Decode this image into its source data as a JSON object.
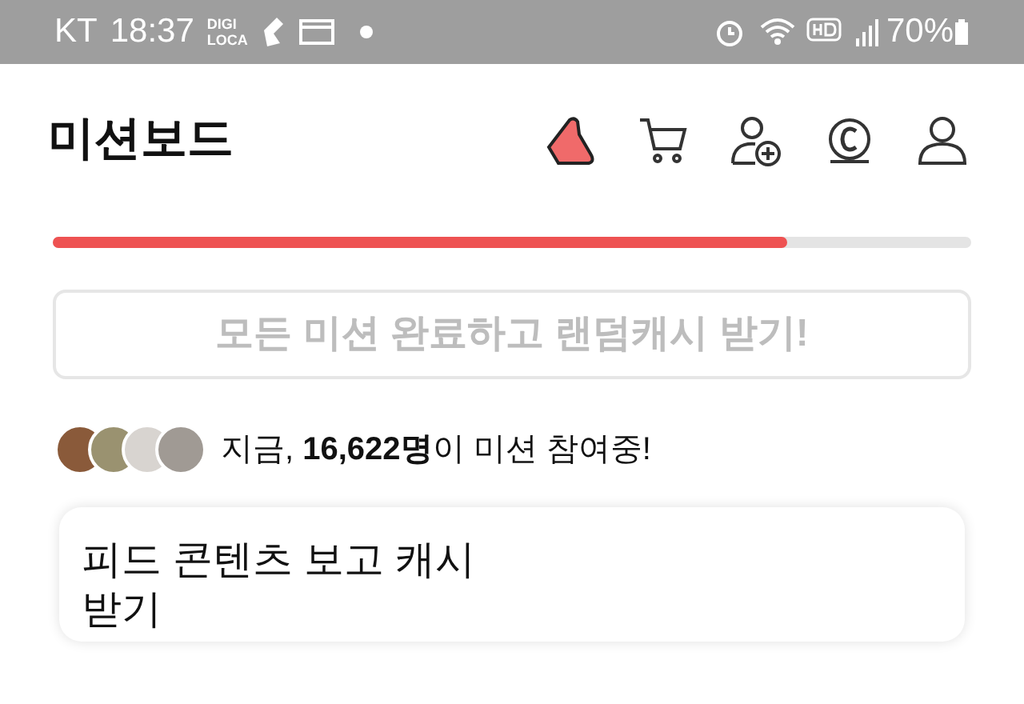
{
  "status_bar": {
    "carrier": "KT",
    "time": "18:37",
    "app_badge": [
      "DIGI",
      "LOCA"
    ],
    "battery": "70%"
  },
  "header": {
    "title": "미션보드"
  },
  "progress": {
    "level": 0.8
  },
  "reward_button": {
    "label": "모든 미션 완료하고 랜덤캐시 받기!",
    "disabled": true
  },
  "participants": {
    "text": "지금, **16,622명**이 미션 참여중!",
    "avatars": [
      {
        "kind": "photo"
      },
      {
        "kind": "photo"
      },
      {
        "kind": "photo"
      },
      {
        "kind": "photo"
      }
    ]
  },
  "feed_card": {
    "title": "피드 콘텐츠 보고 캐시 받기"
  }
}
